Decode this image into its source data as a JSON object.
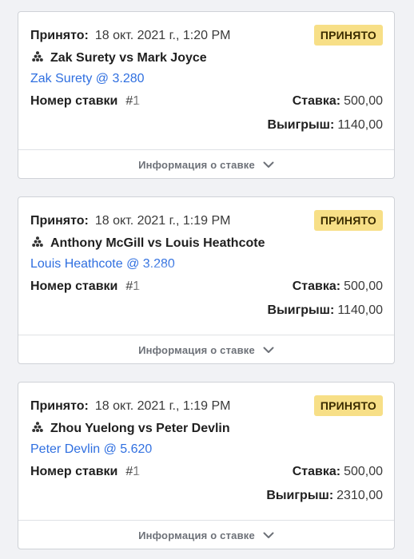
{
  "bets": [
    {
      "accepted_label": "Принято:",
      "accepted_time": "18 окт. 2021 г., 1:20 PM",
      "status": "ПРИНЯТО",
      "event_icon": "snooker-balls-icon",
      "event": "Zak Surety vs Mark Joyce",
      "selection": "Zak Surety @ 3.280",
      "bet_number_label": "Номер ставки",
      "bet_number_value": "#1",
      "stake_label": "Ставка:",
      "stake_value": "500,00",
      "payout_label": "Выигрыш:",
      "payout_value": "1140,00",
      "details_label": "Информация о ставке"
    },
    {
      "accepted_label": "Принято:",
      "accepted_time": "18 окт. 2021 г., 1:19 PM",
      "status": "ПРИНЯТО",
      "event_icon": "snooker-balls-icon",
      "event": "Anthony McGill vs Louis Heathcote",
      "selection": "Louis Heathcote @ 3.280",
      "bet_number_label": "Номер ставки",
      "bet_number_value": "#1",
      "stake_label": "Ставка:",
      "stake_value": "500,00",
      "payout_label": "Выигрыш:",
      "payout_value": "1140,00",
      "details_label": "Информация о ставке"
    },
    {
      "accepted_label": "Принято:",
      "accepted_time": "18 окт. 2021 г., 1:19 PM",
      "status": "ПРИНЯТО",
      "event_icon": "snooker-balls-icon",
      "event": "Zhou Yuelong vs Peter Devlin",
      "selection": "Peter Devlin @ 5.620",
      "bet_number_label": "Номер ставки",
      "bet_number_value": "#1",
      "stake_label": "Ставка:",
      "stake_value": "500,00",
      "payout_label": "Выигрыш:",
      "payout_value": "2310,00",
      "details_label": "Информация о ставке"
    }
  ],
  "colors": {
    "page_background": "#f1f2f5",
    "status_badge": "#f7df87",
    "selection_link": "#2f6fe0"
  }
}
